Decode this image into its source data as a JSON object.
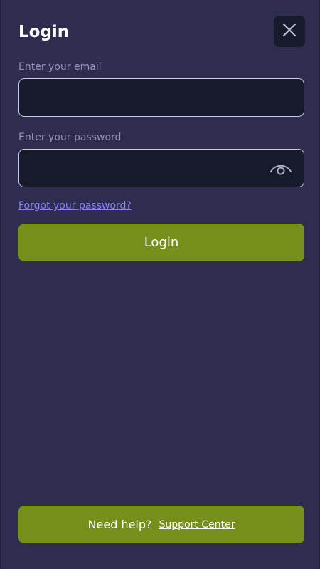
{
  "header": {
    "title": "Login",
    "close_icon": "close-icon"
  },
  "email": {
    "label": "Enter your email",
    "value": "",
    "placeholder": ""
  },
  "password": {
    "label": "Enter your password",
    "value": "",
    "placeholder": "",
    "toggle_icon": "eye-icon"
  },
  "forgot_link": "Forgot your password?",
  "login_button": "Login",
  "help": {
    "text": "Need help?",
    "link": "Support Center"
  },
  "colors": {
    "background": "#2e2d50",
    "input_background": "#161a2a",
    "accent_green": "#768f1b",
    "link_purple": "#8b83f0",
    "label_gray": "#9795b5"
  }
}
